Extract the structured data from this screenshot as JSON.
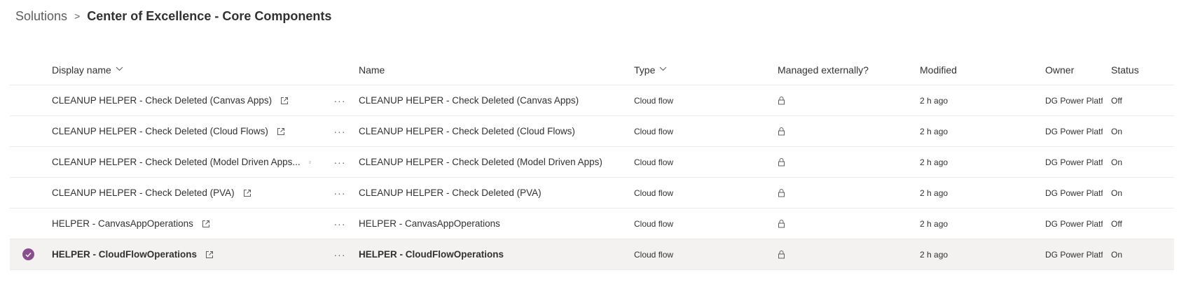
{
  "breadcrumb": {
    "root": "Solutions",
    "separator": ">",
    "current": "Center of Excellence - Core Components"
  },
  "table": {
    "headers": {
      "display_name": "Display name",
      "name": "Name",
      "type": "Type",
      "managed": "Managed externally?",
      "modified": "Modified",
      "owner": "Owner",
      "status": "Status"
    },
    "more_glyph": "···",
    "rows": [
      {
        "display_name": "CLEANUP HELPER - Check Deleted (Canvas Apps)",
        "name": "CLEANUP HELPER - Check Deleted (Canvas Apps)",
        "type": "Cloud flow",
        "modified": "2 h ago",
        "owner": "DG Power Platfo",
        "status": "Off",
        "selected": false
      },
      {
        "display_name": "CLEANUP HELPER - Check Deleted (Cloud Flows)",
        "name": "CLEANUP HELPER - Check Deleted (Cloud Flows)",
        "type": "Cloud flow",
        "modified": "2 h ago",
        "owner": "DG Power Platfo",
        "status": "On",
        "selected": false
      },
      {
        "display_name": "CLEANUP HELPER - Check Deleted (Model Driven Apps...",
        "name": "CLEANUP HELPER - Check Deleted (Model Driven Apps)",
        "type": "Cloud flow",
        "modified": "2 h ago",
        "owner": "DG Power Platfo",
        "status": "On",
        "selected": false
      },
      {
        "display_name": "CLEANUP HELPER - Check Deleted (PVA)",
        "name": "CLEANUP HELPER - Check Deleted (PVA)",
        "type": "Cloud flow",
        "modified": "2 h ago",
        "owner": "DG Power Platfo",
        "status": "On",
        "selected": false
      },
      {
        "display_name": "HELPER - CanvasAppOperations",
        "name": "HELPER - CanvasAppOperations",
        "type": "Cloud flow",
        "modified": "2 h ago",
        "owner": "DG Power Platfo",
        "status": "Off",
        "selected": false
      },
      {
        "display_name": "HELPER - CloudFlowOperations",
        "name": "HELPER - CloudFlowOperations",
        "type": "Cloud flow",
        "modified": "2 h ago",
        "owner": "DG Power Platfo",
        "status": "On",
        "selected": true
      }
    ]
  },
  "icons": {
    "open": "open-in-new-icon",
    "lock": "lock-icon",
    "check": "checkmark-circle-icon",
    "sort": "chevron-down-icon"
  },
  "colors": {
    "selected_check": "#8a4e8f",
    "selected_row_bg": "#f3f2f1"
  }
}
